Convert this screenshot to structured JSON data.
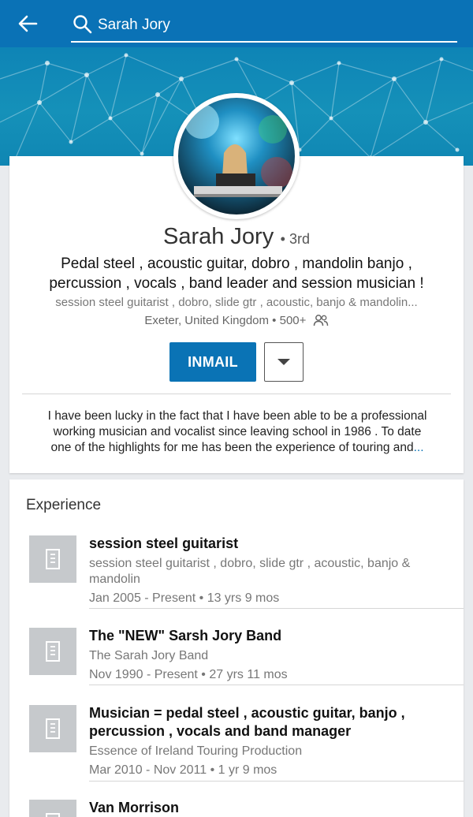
{
  "search": {
    "query": "Sarah Jory"
  },
  "profile": {
    "name": "Sarah Jory",
    "degree": "• 3rd",
    "headline": "Pedal steel , acoustic guitar, dobro , mandolin banjo , percussion , vocals , band leader and session musician !",
    "current": "session steel guitarist , dobro, slide gtr , acoustic, banjo & mandolin...",
    "location": "Exeter, United Kingdom • 500+",
    "inmail_label": "INMAIL",
    "summary_lines": [
      "I have been lucky in the fact that I have been able to be a professional",
      "working musician and vocalist since leaving school in 1986 . To date",
      "one of the highlights for me has been the experience of touring and"
    ],
    "summary_ellipsis": "..."
  },
  "experience": {
    "title": "Experience",
    "items": [
      {
        "role": "session steel guitarist",
        "company": "session steel guitarist , dobro, slide gtr , acoustic, banjo & mandolin",
        "dates": "Jan 2005 - Present • 13 yrs 9 mos"
      },
      {
        "role": "The \"NEW\" Sarsh Jory Band",
        "company": "The Sarah Jory Band",
        "dates": "Nov 1990 - Present • 27 yrs 11 mos"
      },
      {
        "role": "Musician = pedal steel , acoustic guitar, banjo , percussion , vocals and band manager",
        "company": "Essence of Ireland Touring Production",
        "dates": "Mar 2010 - Nov 2011 • 1 yr 9 mos"
      },
      {
        "role": "Van Morrison",
        "company": "",
        "dates": ""
      }
    ]
  },
  "icons": {
    "back": "arrow-left-icon",
    "search": "search-icon",
    "connections": "people-icon",
    "more": "caret-down-icon",
    "company_logo": "building-icon"
  },
  "colors": {
    "brand_blue": "#0a72b6",
    "banner": "#1591b9",
    "logo_placeholder": "#c6c9cc"
  }
}
